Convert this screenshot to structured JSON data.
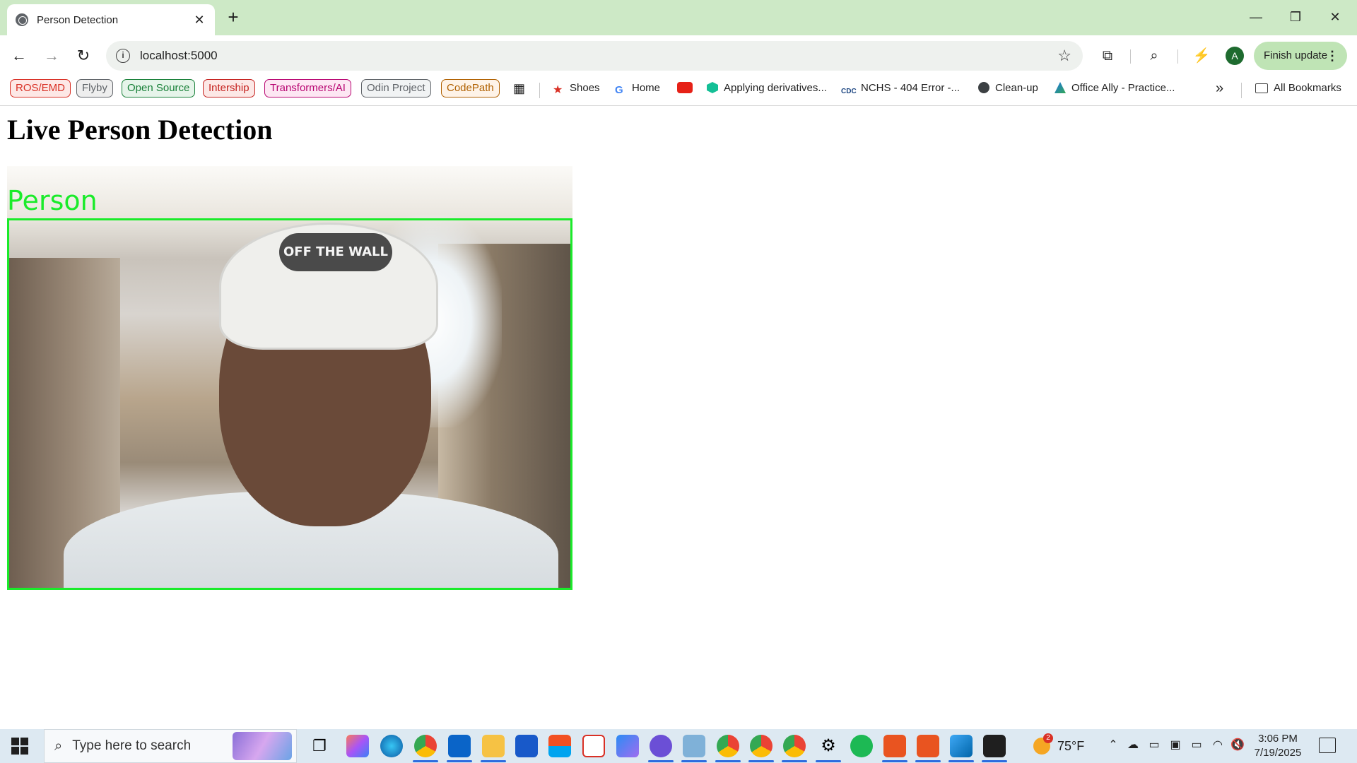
{
  "browser": {
    "tab_title": "Person Detection",
    "tab_close": "✕",
    "new_tab": "+",
    "url": "localhost:5000",
    "finish_update": "Finish update",
    "avatar_letter": "A",
    "window_controls": {
      "minimize": "—",
      "maximize": "❐",
      "close": "✕"
    }
  },
  "bookmarks": {
    "pills": [
      {
        "label": "ROS/EMD",
        "color": "#d93025",
        "bg": "#fde8e6"
      },
      {
        "label": "Flyby",
        "color": "#5f6368",
        "bg": "#eeeeee"
      },
      {
        "label": "Open Source",
        "color": "#188038",
        "bg": "#e6f4ea"
      },
      {
        "label": "Intership",
        "color": "#c5221f",
        "bg": "#fce8e6"
      },
      {
        "label": "Transformers/AI",
        "color": "#b80672",
        "bg": "#fde7f3"
      },
      {
        "label": "Odin Project",
        "color": "#5f6368",
        "bg": "#f1f3f4"
      },
      {
        "label": "CodePath",
        "color": "#b06000",
        "bg": "#fef3e8"
      }
    ],
    "links": [
      {
        "label": "Shoes",
        "icon": "star-icon"
      },
      {
        "label": "Home",
        "icon": "google-icon"
      },
      {
        "label": "",
        "icon": "youtube-icon"
      },
      {
        "label": "Applying derivatives...",
        "icon": "khan-academy-icon"
      },
      {
        "label": "NCHS - 404 Error -...",
        "icon": "cdc-icon"
      },
      {
        "label": "Clean-up",
        "icon": "globe-icon"
      },
      {
        "label": "Office Ally - Practice...",
        "icon": "office-ally-icon"
      }
    ],
    "more": "»",
    "all_bookmarks": "All Bookmarks"
  },
  "page": {
    "heading": "Live Person Detection",
    "detection_label": "Person",
    "cap_text": "OFF THE WALL",
    "box_color": "#1aeb2a"
  },
  "taskbar": {
    "search_placeholder": "Type here to search",
    "weather_temp": "75°F",
    "weather_badge": "2",
    "time": "3:06 PM",
    "date": "7/19/2025"
  }
}
